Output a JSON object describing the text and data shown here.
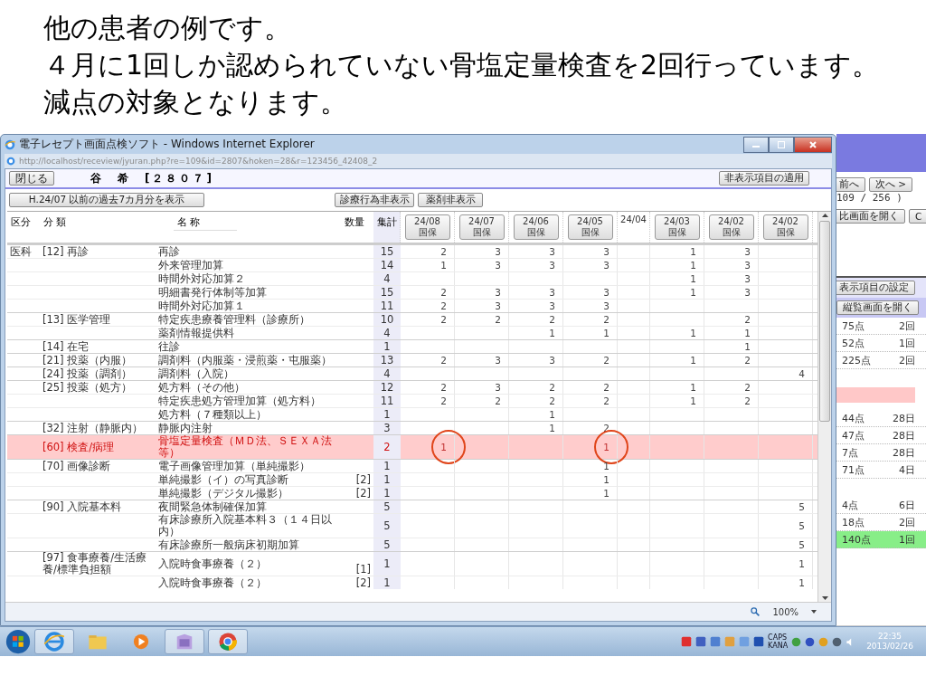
{
  "slide": {
    "lines": [
      "他の患者の例です。",
      "４月に1回しか認められていない骨塩定量検査を2回行っています。",
      "減点の対象となります。"
    ]
  },
  "window": {
    "title": "電子レセプト画面点検ソフト - Windows Internet Explorer",
    "address": "http://localhost/receview/jyuran.php?re=109&id=2807&hoken=28&r=123456_42408_2",
    "zoom": "100%"
  },
  "page": {
    "close_button": "閉じる",
    "patient": "谷　希　[２８０７]",
    "apply_button": "非表示項目の適用",
    "history_button": "H.24/07 以前の過去7カ月分を表示",
    "filter_buttons": [
      "診療行為非表示",
      "薬剤非表示"
    ]
  },
  "table": {
    "columns": [
      "区分",
      "分 類",
      "名 称",
      "数量",
      "集計"
    ],
    "months": [
      {
        "label": "24/08",
        "insurance": "国保"
      },
      {
        "label": "24/07",
        "insurance": "国保"
      },
      {
        "label": "24/06",
        "insurance": "国保"
      },
      {
        "label": "24/05",
        "insurance": "国保"
      },
      {
        "label": "24/04"
      },
      {
        "label": "24/03",
        "insurance": "国保"
      },
      {
        "label": "24/02",
        "insurance": "国保"
      },
      {
        "label": "24/02",
        "insurance": "国保"
      }
    ],
    "rows": [
      {
        "section": "医科",
        "category": "[12] 再診",
        "name": "再診",
        "total": "15",
        "alert": false,
        "values": {
          "col_1": "2",
          "col_2": "3",
          "col_3": "3",
          "col_4": "3",
          "col_6": "1",
          "col_7": "3"
        }
      },
      {
        "name": "外来管理加算",
        "total": "14",
        "alert": false,
        "values": {
          "col_1": "1",
          "col_2": "3",
          "col_3": "3",
          "col_4": "3",
          "col_6": "1",
          "col_7": "3"
        }
      },
      {
        "name": "時間外対応加算２",
        "total": "4",
        "alert": false,
        "values": {
          "col_6": "1",
          "col_7": "3"
        }
      },
      {
        "name": "明細書発行体制等加算",
        "total": "15",
        "alert": false,
        "values": {
          "col_1": "2",
          "col_2": "3",
          "col_3": "3",
          "col_4": "3",
          "col_6": "1",
          "col_7": "3"
        }
      },
      {
        "name": "時間外対応加算１",
        "total": "11",
        "alert": false,
        "values": {
          "col_1": "2",
          "col_2": "3",
          "col_3": "3",
          "col_4": "3"
        }
      },
      {
        "category": "[13] 医学管理",
        "name": "特定疾患療養管理料（診療所）",
        "total": "10",
        "alert": false,
        "values": {
          "col_1": "2",
          "col_2": "2",
          "col_3": "2",
          "col_4": "2",
          "col_7": "2"
        }
      },
      {
        "name": "薬剤情報提供料",
        "total": "4",
        "alert": false,
        "values": {
          "col_3": "1",
          "col_4": "1",
          "col_6": "1",
          "col_7": "1"
        }
      },
      {
        "category": "[14] 在宅",
        "name": "往診",
        "total": "1",
        "alert": false,
        "values": {
          "col_7": "1"
        }
      },
      {
        "category": "[21] 投薬（内服）",
        "name": "調剤料（内服薬・浸煎薬・屯服薬）",
        "total": "13",
        "alert": false,
        "values": {
          "col_1": "2",
          "col_2": "3",
          "col_3": "3",
          "col_4": "2",
          "col_6": "1",
          "col_7": "2"
        }
      },
      {
        "category": "[24] 投薬（調剤）",
        "name": "調剤料（入院）",
        "total": "4",
        "alert": false,
        "values": {
          "col_8": "4"
        }
      },
      {
        "category": "[25] 投薬（処方）",
        "name": "処方料（その他）",
        "total": "12",
        "alert": false,
        "values": {
          "col_1": "2",
          "col_2": "3",
          "col_3": "2",
          "col_4": "2",
          "col_6": "1",
          "col_7": "2"
        }
      },
      {
        "name": "特定疾患処方管理加算（処方料）",
        "total": "11",
        "alert": false,
        "values": {
          "col_1": "2",
          "col_2": "2",
          "col_3": "2",
          "col_4": "2",
          "col_6": "1",
          "col_7": "2"
        }
      },
      {
        "name": "処方料（７種類以上）",
        "total": "1",
        "alert": false,
        "values": {
          "col_3": "1"
        }
      },
      {
        "category": "[32] 注射（静脈内）",
        "name": "静脈内注射",
        "total": "3",
        "alert": false,
        "values": {
          "col_3": "1",
          "col_4": "2"
        }
      },
      {
        "category": "[60] 検査/病理",
        "name": "骨塩定量検査（ＭＤ法、ＳＥＸＡ法等）",
        "total": "2",
        "alert": true,
        "values": {
          "col_1": {
            "value": "1",
            "circled": true
          },
          "col_4": {
            "value": "1",
            "circled": true
          }
        }
      },
      {
        "category": "[70] 画像診断",
        "name": "電子画像管理加算（単純撮影）",
        "total": "1",
        "alert": false,
        "values": {
          "col_4": "1"
        }
      },
      {
        "name": "単純撮影（イ）の写真診断",
        "qty": "[2]",
        "total": "1",
        "alert": false,
        "values": {
          "col_4": "1"
        }
      },
      {
        "name": "単純撮影（デジタル撮影）",
        "qty": "[2]",
        "total": "1",
        "alert": false,
        "values": {
          "col_4": "1"
        }
      },
      {
        "category": "[90] 入院基本料",
        "name": "夜間緊急体制確保加算",
        "total": "5",
        "alert": false,
        "values": {
          "col_8": "5"
        }
      },
      {
        "name": "有床診療所入院基本料３（１４日以内）",
        "total": "5",
        "alert": false,
        "values": {
          "col_8": "5"
        }
      },
      {
        "name": "有床診療所一般病床初期加算",
        "total": "5",
        "alert": false,
        "values": {
          "col_8": "5"
        }
      },
      {
        "category": "[97] 食事療養/生活療養/標準負担額",
        "name": "入院時食事療養（２）",
        "qty": "[1]",
        "total": "1",
        "alert": false,
        "values": {
          "col_8": "1"
        }
      },
      {
        "name": "入院時食事療養（２）",
        "qty": "[2]",
        "total": "1",
        "alert": false,
        "values": {
          "col_8": "1"
        }
      }
    ]
  },
  "back_window": {
    "prev_button": "前へ",
    "next_button": "次へ >",
    "counter": "109 / 256 )",
    "compare_button": "比画面を開く",
    "c_button": "C",
    "settings_button": "表示項目の設定",
    "review_button": "縦覧画面を開く",
    "groups": [
      [
        {
          "points": "75点",
          "count": "2回",
          "highlighted": false
        },
        {
          "points": "52点",
          "count": "1回",
          "highlighted": false
        },
        {
          "points": "225点",
          "count": "2回",
          "highlighted": false
        }
      ],
      [
        {
          "kind": "alert"
        }
      ],
      [
        {
          "points": "44点",
          "count": "28日",
          "highlighted": false
        },
        {
          "points": "47点",
          "count": "28日",
          "highlighted": false
        },
        {
          "points": "7点",
          "count": "28日",
          "highlighted": false
        },
        {
          "points": "71点",
          "count": "4日",
          "highlighted": false
        }
      ],
      [
        {
          "points": "4点",
          "count": "6日",
          "highlighted": false
        },
        {
          "points": "18点",
          "count": "2回",
          "highlighted": false
        },
        {
          "points": "140点",
          "count": "1回",
          "highlighted": true
        }
      ]
    ]
  },
  "taskbar": {
    "tray": [
      "CAPS",
      "KANA"
    ],
    "time": "22:35",
    "date": "2013/02/26"
  }
}
